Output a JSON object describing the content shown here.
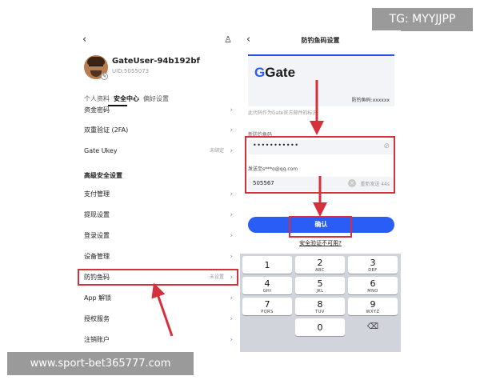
{
  "badges": {
    "telegram": "TG: MYYJJPP",
    "watermark": "www.sport-bet365777.com"
  },
  "left": {
    "user": {
      "name": "GateUser-94b192bf",
      "uid": "UID:5055073"
    },
    "tabs": [
      {
        "label": "个人资料"
      },
      {
        "label": "安全中心"
      },
      {
        "label": "偏好设置"
      }
    ],
    "menu": {
      "funds_password": "资金密码",
      "two_fa": "双重验证 (2FA)",
      "ukey": "Gate Ukey",
      "ukey_status": "未绑定",
      "advanced_header": "高级安全设置",
      "payment_mgmt": "支付管理",
      "withdraw": "提现设置",
      "login": "登录设置",
      "device": "设备管理",
      "anti_phishing": "防钓鱼码",
      "anti_phishing_status": "未设置",
      "app_unlock": "App 解锁",
      "auth_service": "授权服务",
      "cancel_account": "注销账户"
    }
  },
  "right": {
    "title": "防钓鱼码设置",
    "logo_text": "Gate",
    "card_phish_label": "防钓鱼码:xxxxxx",
    "note": "此代码作为Gate官方邮件的标识",
    "new_code_label": "新防钓鱼码",
    "password_dots": "•••••••••••",
    "sent_to": "发送至s***o@qq.com",
    "verification_code": "505567",
    "resend": "重新发送 44s",
    "confirm": "确认",
    "unavailable": "安全验证不可用?"
  },
  "keyboard": {
    "keys": [
      {
        "num": "1",
        "letters": ""
      },
      {
        "num": "2",
        "letters": "ABC"
      },
      {
        "num": "3",
        "letters": "DEF"
      },
      {
        "num": "4",
        "letters": "GHI"
      },
      {
        "num": "5",
        "letters": "JKL"
      },
      {
        "num": "6",
        "letters": "MNO"
      },
      {
        "num": "7",
        "letters": "PQRS"
      },
      {
        "num": "8",
        "letters": "TUV"
      },
      {
        "num": "9",
        "letters": "WXYZ"
      },
      {
        "num": "0",
        "letters": ""
      }
    ]
  },
  "colors": {
    "accent": "#2a5cf6",
    "highlight": "#d6303d",
    "keyboard_bg": "#d1d4da"
  }
}
